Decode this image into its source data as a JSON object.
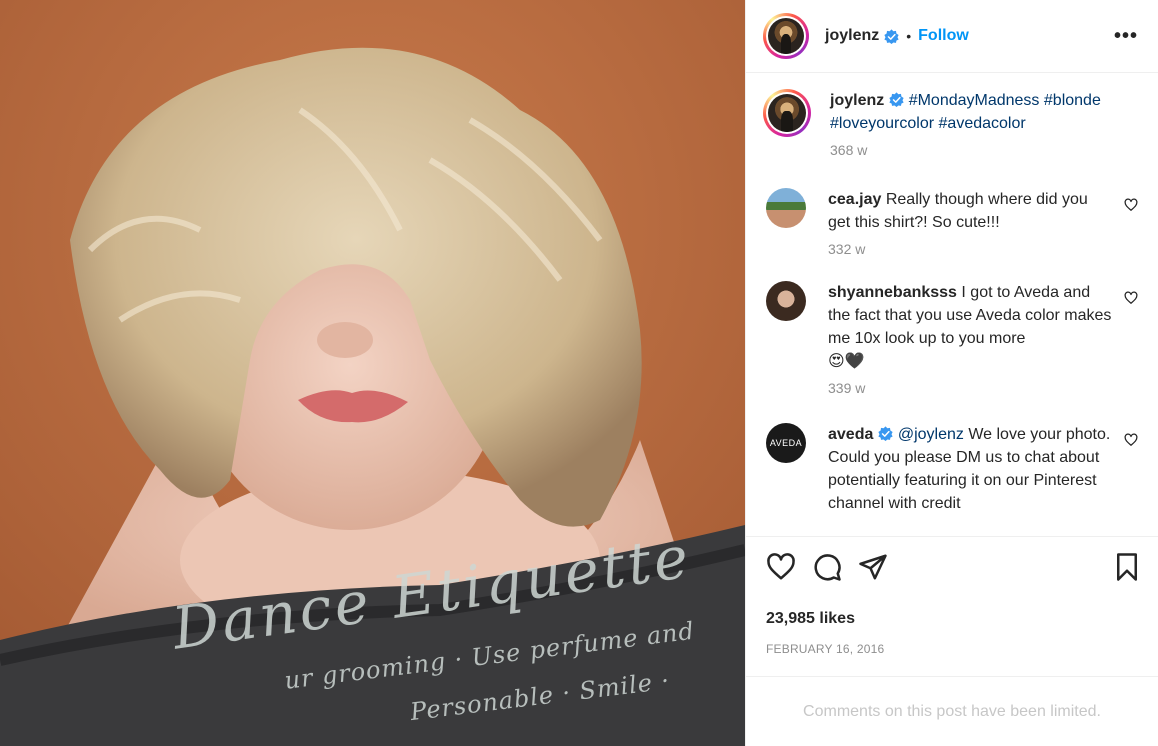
{
  "post": {
    "author": {
      "username": "joylenz",
      "verified": true
    },
    "follow_label": "Follow",
    "separator": "•",
    "more_label": "•••",
    "photo": {
      "shirt_text_line1": "Dance Etiquette",
      "shirt_text_line2": "ur grooming · Use perfume and",
      "shirt_text_line3": "Personable · Smile ·"
    },
    "caption": {
      "username": "joylenz",
      "verified": true,
      "tags": [
        "#MondayMadness",
        "#blonde",
        "#loveyourcolor",
        "#avedacolor"
      ],
      "time": "368 w"
    },
    "comments": [
      {
        "username": "cea.jay",
        "text": "Really though where did you get this shirt?! So cute!!!",
        "time": "332 w"
      },
      {
        "username": "shyannebanksss",
        "text": "I got to Aveda and the fact that you use Aveda color makes me 10x look up to you more",
        "emoji": "😍🖤",
        "time": "339 w"
      },
      {
        "username": "aveda",
        "verified": true,
        "mention": "@joylenz",
        "text": "We love your photo. Could you please DM us to chat about potentially featuring it on our Pinterest channel with credit",
        "avatar_text": "AVEDA"
      }
    ],
    "likes": "23,985 likes",
    "date": "FEBRUARY 16, 2016",
    "comments_notice": "Comments on this post have been limited.",
    "icons": {
      "verified": "verified-badge-icon",
      "like": "heart-icon",
      "comment": "comment-bubble-icon",
      "share": "paper-plane-icon",
      "save": "bookmark-icon",
      "more": "more-options-icon"
    },
    "colors": {
      "accent": "#0095f6",
      "hashtag": "#00376b",
      "muted": "#8e8e8e",
      "notice": "#c7c7c7"
    }
  }
}
